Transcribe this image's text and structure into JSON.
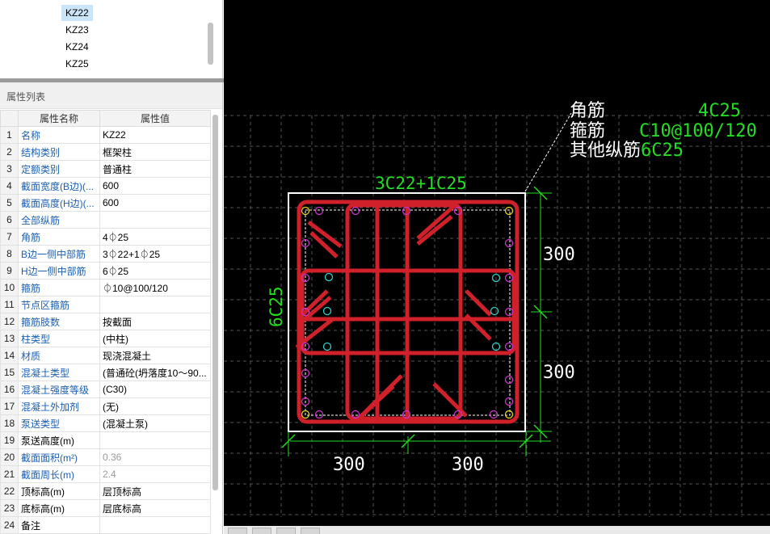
{
  "tree": {
    "items": [
      {
        "label": "KZ22",
        "selected": true
      },
      {
        "label": "KZ23",
        "selected": false
      },
      {
        "label": "KZ24",
        "selected": false
      },
      {
        "label": "KZ25",
        "selected": false
      }
    ]
  },
  "properties": {
    "title": "属性列表",
    "col_name": "属性名称",
    "col_value": "属性值",
    "rows": [
      {
        "idx": "1",
        "name": "名称",
        "value": "KZ22",
        "blue": true
      },
      {
        "idx": "2",
        "name": "结构类别",
        "value": "框架柱",
        "blue": true
      },
      {
        "idx": "3",
        "name": "定额类别",
        "value": "普通柱",
        "blue": true
      },
      {
        "idx": "4",
        "name": "截面宽度(B边)(...",
        "value": "600",
        "blue": true
      },
      {
        "idx": "5",
        "name": "截面高度(H边)(...",
        "value": "600",
        "blue": true
      },
      {
        "idx": "6",
        "name": "全部纵筋",
        "value": "",
        "blue": true
      },
      {
        "idx": "7",
        "name": "角筋",
        "value": "4⏀25",
        "blue": true
      },
      {
        "idx": "8",
        "name": "B边一侧中部筋",
        "value": "3⏀22+1⏀25",
        "blue": true
      },
      {
        "idx": "9",
        "name": "H边一侧中部筋",
        "value": "6⏀25",
        "blue": true
      },
      {
        "idx": "10",
        "name": "箍筋",
        "value": "⏀10@100/120",
        "blue": true
      },
      {
        "idx": "11",
        "name": "节点区箍筋",
        "value": "",
        "blue": true
      },
      {
        "idx": "12",
        "name": "箍筋肢数",
        "value": "按截面",
        "blue": true
      },
      {
        "idx": "13",
        "name": "柱类型",
        "value": "(中柱)",
        "blue": true
      },
      {
        "idx": "14",
        "name": "材质",
        "value": "现浇混凝土",
        "blue": true
      },
      {
        "idx": "15",
        "name": "混凝土类型",
        "value": "(普通砼(坍落度10～90...",
        "blue": true
      },
      {
        "idx": "16",
        "name": "混凝土强度等级",
        "value": "(C30)",
        "blue": true
      },
      {
        "idx": "17",
        "name": "混凝土外加剂",
        "value": "(无)",
        "blue": true
      },
      {
        "idx": "18",
        "name": "泵送类型",
        "value": "(混凝土泵)",
        "blue": true
      },
      {
        "idx": "19",
        "name": "泵送高度(m)",
        "value": "",
        "blue": false
      },
      {
        "idx": "20",
        "name": "截面面积(m²)",
        "value": "0.36",
        "blue": true,
        "gray": true
      },
      {
        "idx": "21",
        "name": "截面周长(m)",
        "value": "2.4",
        "blue": true,
        "gray": true
      },
      {
        "idx": "22",
        "name": "顶标高(m)",
        "value": "层顶标高",
        "blue": false
      },
      {
        "idx": "23",
        "name": "底标高(m)",
        "value": "层底标高",
        "blue": false
      },
      {
        "idx": "24",
        "name": "备注",
        "value": "",
        "blue": false
      }
    ]
  },
  "drawing": {
    "legend": [
      {
        "label": "角筋",
        "value": "4C25"
      },
      {
        "label": "箍筋",
        "value": "C10@100/120"
      },
      {
        "label": "其他纵筋",
        "value": "6C25"
      }
    ],
    "top_label": "3C22+1C25",
    "left_label": "6C25",
    "dim_right_top": "300",
    "dim_right_bottom": "300",
    "dim_bottom_left": "300",
    "dim_bottom_right": "300",
    "colors": {
      "background": "#000000",
      "stirrup": "#d0202a",
      "green": "#22dd22",
      "grid": "#555555",
      "white": "#ffffff",
      "bar_magenta": "#cc33cc",
      "bar_cyan": "#33cccc",
      "bar_yellow": "#e8d020"
    }
  }
}
